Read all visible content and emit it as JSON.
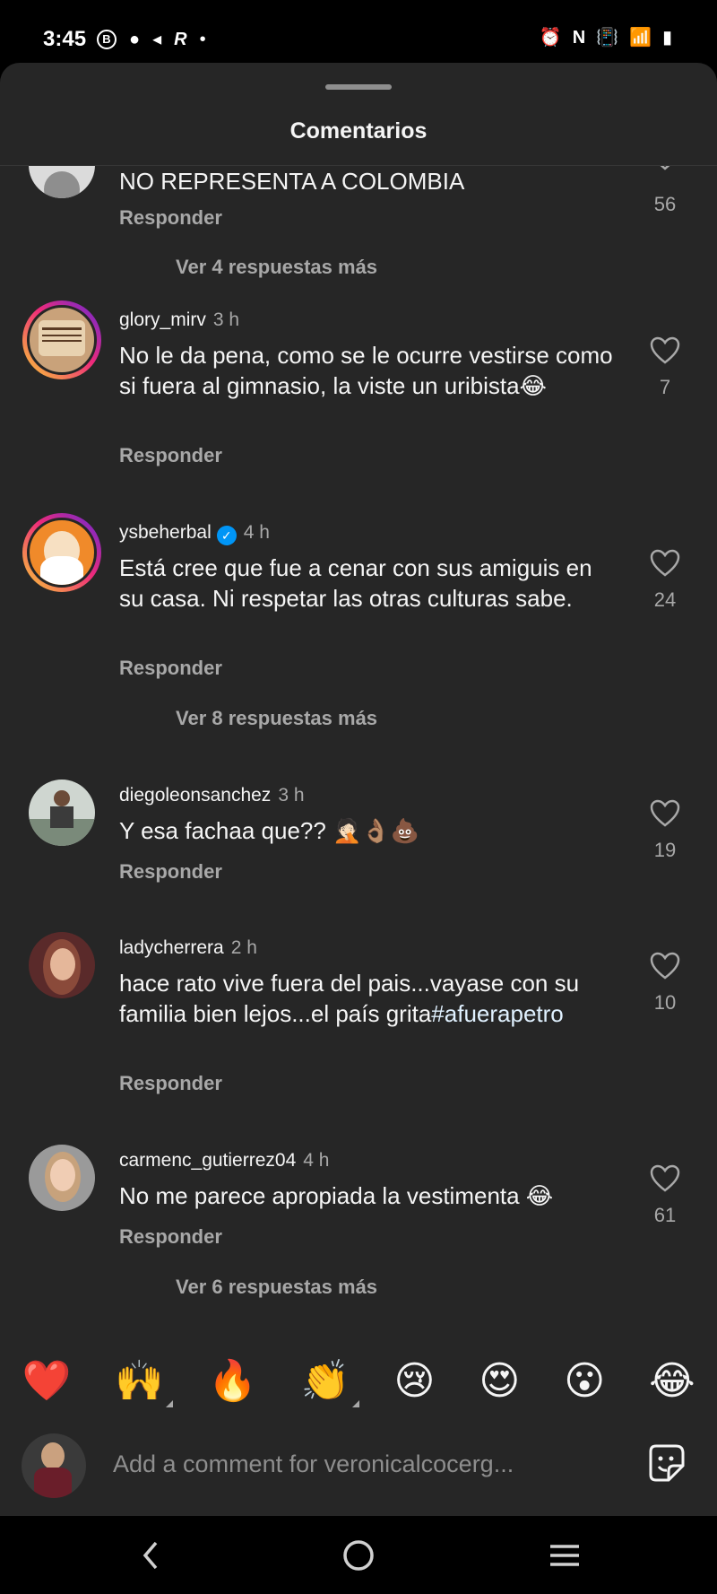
{
  "status_bar": {
    "time": "3:45",
    "left_icons": [
      "B",
      "●",
      "◂",
      "R",
      "•"
    ],
    "right_icons": [
      "⏰",
      "N",
      "📳",
      "📶",
      "▮"
    ]
  },
  "sheet": {
    "title": "Comentarios"
  },
  "comments": [
    {
      "username": "",
      "time": "",
      "text": "NO REPRESENTA A COLOMBIA",
      "reply_label": "Responder",
      "likes": "56",
      "view_more": "Ver 4 respuestas más"
    },
    {
      "username": "glory_mirv",
      "time": "3 h",
      "text": "No le da pena, como se le ocurre vestirse como si fuera al gimnasio, la viste un uribista😂",
      "reply_label": "Responder",
      "likes": "7"
    },
    {
      "username": "ysbeherbal",
      "time": "4 h",
      "text": "Está cree que fue a cenar con sus amiguis en su casa. Ni respetar las otras culturas sabe.",
      "reply_label": "Responder",
      "likes": "24",
      "view_more": "Ver 8 respuestas más"
    },
    {
      "username": "diegoleonsanchez",
      "time": "3 h",
      "text": "Y esa fachaa que?? 🤦🏻👌🏽💩",
      "reply_label": "Responder",
      "likes": "19"
    },
    {
      "username": "ladycherrera",
      "time": "2 h",
      "text_plain": "hace rato vive fuera del pais...vayase con su familia bien lejos...el país grita",
      "hashtag": "#afuerapetro",
      "reply_label": "Responder",
      "likes": "10"
    },
    {
      "username": "carmenc_gutierrez04",
      "time": "4 h",
      "text": "No me parece apropiada la vestimenta 😂",
      "reply_label": "Responder",
      "likes": "61",
      "view_more": "Ver 6 respuestas más"
    }
  ],
  "reactions": [
    "❤️",
    "🙌",
    "🔥",
    "👏",
    "😢",
    "😍",
    "😮",
    "😂"
  ],
  "composer": {
    "placeholder": "Add a comment for veronicalcocerg..."
  },
  "nav": {
    "back": "back-icon",
    "home": "home-icon",
    "recents": "recents-icon"
  },
  "colors": {
    "sheet_bg": "#262626",
    "secondary_text": "#a8a8a8",
    "verified_blue": "#0095f6",
    "heart_outline": "#a8a8a8"
  }
}
